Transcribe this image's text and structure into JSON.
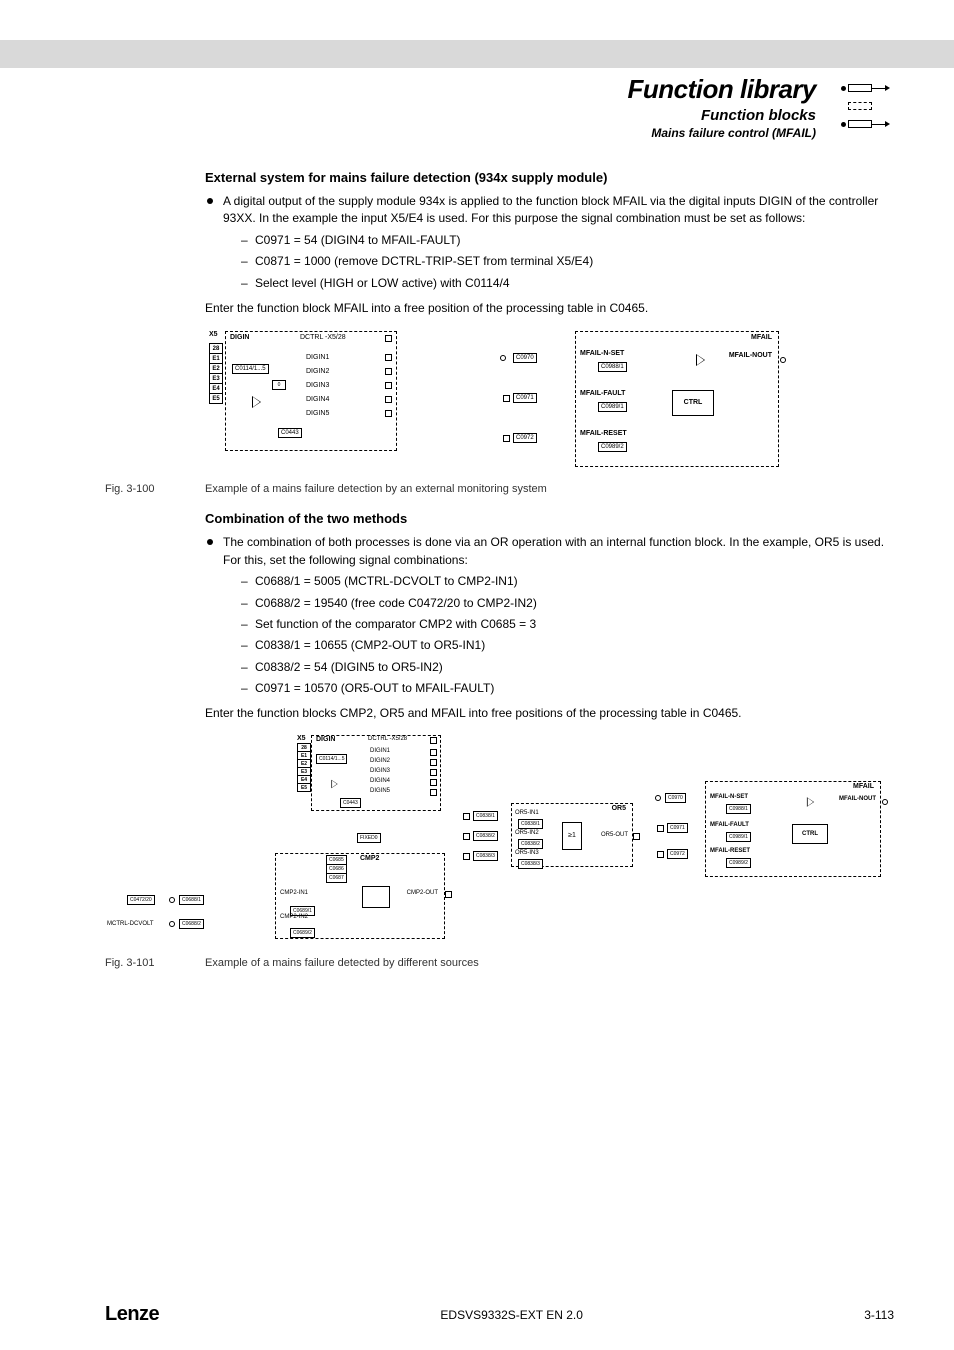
{
  "header": {
    "title": "Function library",
    "subtitle": "Function blocks",
    "subsubtitle": "Mains failure control (MFAIL)"
  },
  "section1": {
    "title": "External system for mains failure detection (934x supply module)",
    "bullet": "A digital output of the supply module 934x is applied to the function block MFAIL via the digital inputs DIGIN of the controller 93XX. In the example the input X5/E4 is used. For this purpose the signal combination must be set as follows:",
    "dashes": [
      "C0971 = 54 (DIGIN4 to MFAIL-FAULT)",
      "C0871 = 1000 (remove DCTRL-TRIP-SET from terminal X5/E4)",
      "Select level (HIGH or LOW active) with C0114/4"
    ],
    "instruction": "Enter the function block MFAIL into a free position of the processing table in C0465."
  },
  "fig100": {
    "num": "Fig. 3-100",
    "caption": "Example of a mains failure detection by an external monitoring system",
    "labels": {
      "x5": "X5",
      "digin_title": "DIGIN",
      "dctrl": "DCTRL -X5/28",
      "terms": [
        "28",
        "E1",
        "E2",
        "E3",
        "E4",
        "E5"
      ],
      "c0114": "C0114/1...5",
      "digins": [
        "DIGIN1",
        "DIGIN2",
        "DIGIN3",
        "DIGIN4",
        "DIGIN5"
      ],
      "c0443": "C0443",
      "c0970": "C0970",
      "c0971": "C0971",
      "c0972": "C0972",
      "mfail_nset": "MFAIL-N-SET",
      "c0988_1": "C0988/1",
      "mfail_fault": "MFAIL-FAULT",
      "c0989_1": "C0989/1",
      "mfail_reset": "MFAIL-RESET",
      "c0989_2": "C0989/2",
      "ctrl": "CTRL",
      "mfail": "MFAIL",
      "mfail_nout": "MFAIL-NOUT"
    }
  },
  "section2": {
    "title": "Combination of the two methods",
    "bullet": "The combination of both processes is done via an OR operation with an internal function block. In the example, OR5 is used. For this, set the following signal combinations:",
    "dashes": [
      "C0688/1 = 5005 (MCTRL-DCVOLT to CMP2-IN1)",
      "C0688/2 = 19540 (free code C0472/20 to CMP2-IN2)",
      "Set function of the comparator CMP2 with C0685 = 3",
      "C0838/1 = 10655 (CMP2-OUT to OR5-IN1)",
      "C0838/2 = 54 (DIGIN5 to OR5-IN2)",
      "C0971 = 10570 (OR5-OUT to MFAIL-FAULT)"
    ],
    "instruction": "Enter the function blocks CMP2, OR5 and MFAIL into free positions of the processing table in C0465."
  },
  "fig101": {
    "num": "Fig. 3-101",
    "caption": "Example of a mains failure detected by different sources",
    "labels": {
      "x5": "X5",
      "digin_title": "DIGIN",
      "dctrl": "DCTRL -X5/28",
      "terms": [
        "28",
        "E1",
        "E2",
        "E3",
        "E4",
        "E5"
      ],
      "c0114": "C0114/1...5",
      "digins": [
        "DIGIN1",
        "DIGIN2",
        "DIGIN3",
        "DIGIN4",
        "DIGIN5"
      ],
      "c0443": "C0443",
      "fixed0": "FIXED0",
      "or5": "OR5",
      "or5_in1": "OR5-IN1",
      "or5_in2": "OR5-IN2",
      "or5_in3": "OR5-IN3",
      "or5_out": "OR5-OUT",
      "ge1": "≥1",
      "c0838_1": "C0838/1",
      "c0838_2": "C0838/2",
      "c0838_3": "C0838/3",
      "cmp2": "CMP2",
      "cmp2_in1": "CMP2-IN1",
      "cmp2_in2": "CMP2-IN2",
      "cmp2_out": "CMP2-OUT",
      "c0685": "C0685",
      "c0686": "C0686",
      "c0687": "C0687",
      "c0688_1": "C0688/1",
      "c0688_2": "C0688/2",
      "c0689_1": "C0689/1",
      "c0689_2": "C0689/2",
      "c0472_20": "C0472/20",
      "mctrl": "MCTRL-DCVOLT",
      "mfail": "MFAIL",
      "mfail_nset": "MFAIL-N-SET",
      "mfail_fault": "MFAIL-FAULT",
      "mfail_reset": "MFAIL-RESET",
      "mfail_nout": "MFAIL-NOUT",
      "ctrl": "CTRL",
      "c0970": "C0970",
      "c0971": "C0971",
      "c0972": "C0972",
      "c0988_1": "C0988/1",
      "c0989_1": "C0989/1",
      "c0989_2": "C0989/2"
    }
  },
  "footer": {
    "brand": "Lenze",
    "doc": "EDSVS9332S-EXT EN 2.0",
    "page": "3-113"
  }
}
